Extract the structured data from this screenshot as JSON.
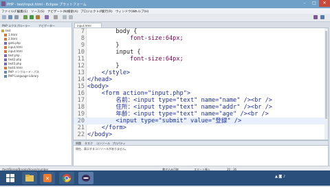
{
  "window": {
    "title": "PHP - test/input.html - Eclipse プラットフォーム",
    "controls": [
      "minimize-icon",
      "maximize-icon",
      "close-icon"
    ]
  },
  "menubar": [
    "ファイル(F)",
    "編集(E)",
    "ソース(S)",
    "ナビゲート(N)",
    "検索(A)",
    "プロジェクト(P)",
    "実行(R)",
    "ウィンドウ(W)",
    "ヘルプ(H)"
  ],
  "left_pane": {
    "tabs": [
      "PHP エクスプローラー",
      "ナビゲーター"
    ],
    "tree": [
      {
        "label": "test",
        "indent": 0
      },
      {
        "label": "1.html",
        "indent": 1
      },
      {
        "label": "2.html",
        "indent": 1
      },
      {
        "label": "goto.php",
        "indent": 1
      },
      {
        "label": "input.html",
        "indent": 1
      },
      {
        "label": "input.html",
        "indent": 1
      },
      {
        "label": "test.php",
        "indent": 1
      },
      {
        "label": "test2.php",
        "indent": 1
      },
      {
        "label": "test3.php",
        "indent": 1
      },
      {
        "label": "test4.html",
        "indent": 1
      },
      {
        "label": "PHP インクルード・パス",
        "indent": 1
      },
      {
        "label": "PHP Language Library",
        "indent": 0
      }
    ]
  },
  "editor": {
    "tab_label": "input.html",
    "lines": [
      {
        "n": "7",
        "text": "        body {"
      },
      {
        "n": "8",
        "text": "            font-size:64px;"
      },
      {
        "n": "9",
        "text": "        }"
      },
      {
        "n": "10",
        "text": "        input {"
      },
      {
        "n": "11",
        "text": "            font-size:64px;"
      },
      {
        "n": "12",
        "text": "        }"
      },
      {
        "n": "13",
        "text": "    </style>"
      },
      {
        "n": "14",
        "text": "</head>"
      },
      {
        "n": "15",
        "text": "<body>"
      },
      {
        "n": "16",
        "text": "    <form action=\"input.php\">"
      },
      {
        "n": "17",
        "text": "        名前：<input type=\"text\" name=\"name\" /><br />"
      },
      {
        "n": "18",
        "text": "        住所：<input type=\"text\" name=\"addr\" /><br />"
      },
      {
        "n": "19",
        "text": "        年齢：<input type=\"text\" name=\"age\" /><br />"
      },
      {
        "n": "20",
        "text": "        <input type=\"submit\" value=\"登録\" />"
      },
      {
        "n": "21",
        "text": "    </form>"
      },
      {
        "n": "22",
        "text": "</body>"
      }
    ],
    "highlighted_line": "20"
  },
  "console": {
    "tabs": [
      "問題",
      "タスク",
      "コンソール",
      "プロパティ"
    ],
    "message": "現在、表示するコンソールがありません。"
  },
  "statusbar": {
    "left": "/test/Baroq/Breaks/Hosse/number",
    "mid1": "書き込み可能",
    "mid2": "スマート挿入",
    "pos": "20 : 36"
  },
  "taskbar": {
    "apps": [
      "windows-start",
      "explorer",
      "xampp",
      "chrome",
      "eclipse-php"
    ]
  }
}
